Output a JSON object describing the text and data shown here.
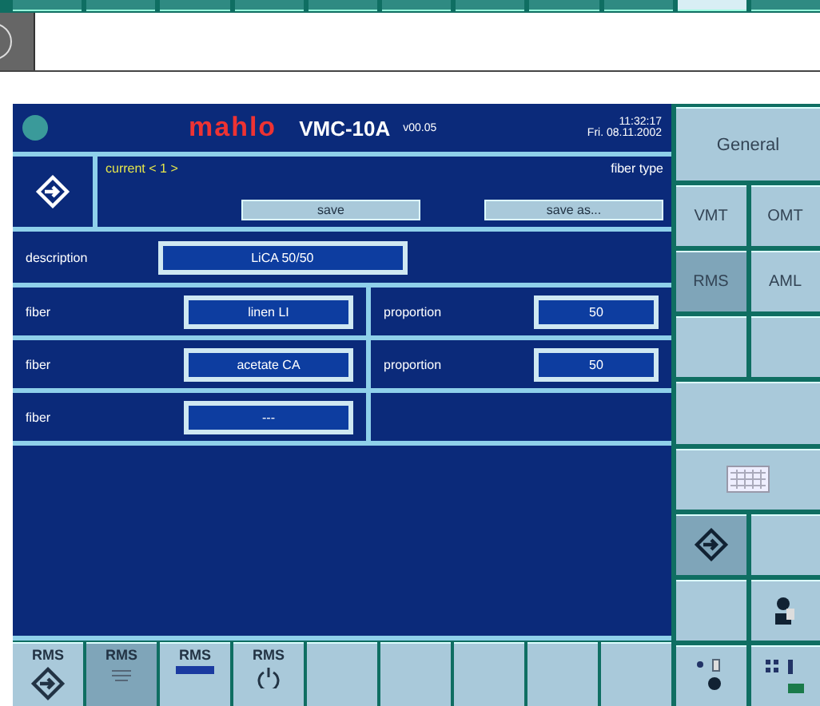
{
  "top_strip": {
    "buttons": [
      {
        "selected": false
      },
      {
        "selected": false
      },
      {
        "selected": false
      },
      {
        "selected": false
      },
      {
        "selected": false
      },
      {
        "selected": false
      },
      {
        "selected": false
      },
      {
        "selected": false
      },
      {
        "selected": false
      },
      {
        "selected": true
      },
      {
        "selected": false
      }
    ]
  },
  "header": {
    "brand": "mahlo",
    "model": "VMC-10A",
    "version": "v00.05",
    "time": "11:32:17",
    "date": "Fri. 08.11.2002"
  },
  "record": {
    "current": "current < 1 >",
    "title": "fiber type",
    "buttons": [
      "save",
      "save as..."
    ]
  },
  "description": {
    "label": "description",
    "value": "LiCA 50/50"
  },
  "fibers": [
    {
      "label": "fiber",
      "value": "linen LI",
      "proportion_label": "proportion",
      "proportion": "50"
    },
    {
      "label": "fiber",
      "value": "acetate CA",
      "proportion_label": "proportion",
      "proportion": "50"
    },
    {
      "label": "fiber",
      "value": "---"
    }
  ],
  "bottom_buttons": [
    {
      "kind": "rms-target",
      "label": "RMS",
      "selected": false
    },
    {
      "kind": "rms-list",
      "label": "RMS",
      "selected": true
    },
    {
      "kind": "rms-bar",
      "label": "RMS",
      "selected": false
    },
    {
      "kind": "rms-power",
      "label": "RMS",
      "selected": false
    },
    {
      "kind": "blank",
      "selected": false
    },
    {
      "kind": "blank",
      "selected": false
    },
    {
      "kind": "blank",
      "selected": false
    },
    {
      "kind": "blank",
      "selected": false
    },
    {
      "kind": "blank",
      "selected": false
    }
  ],
  "side_panel": {
    "general": "General",
    "modes": [
      {
        "label": "VMT",
        "selected": false
      },
      {
        "label": "OMT",
        "selected": false
      },
      {
        "label": "RMS",
        "selected": true
      },
      {
        "label": "AML",
        "selected": false
      }
    ],
    "tools": [
      {
        "kind": "blank",
        "selected": false
      },
      {
        "kind": "blank",
        "selected": false
      },
      {
        "kind": "wide-blank",
        "selected": false
      },
      {
        "kind": "keyboard",
        "selected": false
      },
      {
        "kind": "enter",
        "selected": true
      },
      {
        "kind": "blank",
        "selected": false
      },
      {
        "kind": "blank",
        "selected": false
      },
      {
        "kind": "person",
        "selected": false
      },
      {
        "kind": "status",
        "selected": false
      },
      {
        "kind": "network",
        "selected": false
      }
    ]
  }
}
